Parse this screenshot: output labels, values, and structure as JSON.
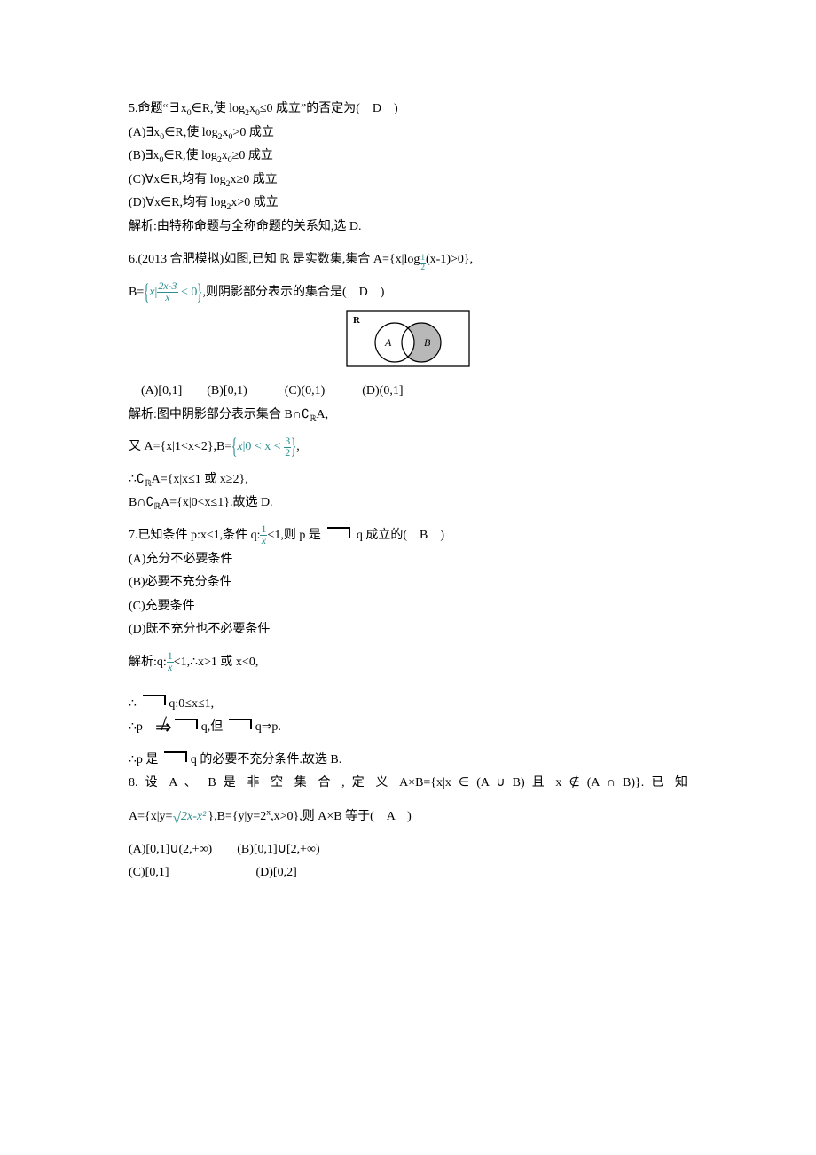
{
  "q5": {
    "stem": "5.命题“∃x₀∈ℝ,使 log₂x₀≤0 成立”的否定为(　D　)",
    "A": "(A)∃x₀∈ℝ,使 log₂x₀>0 成立",
    "B": "(B)∃x₀∈ℝ,使 log₂x₀≥0 成立",
    "C": "(C)∀x∈ℝ,均有 log₂x≥0 成立",
    "D": "(D)∀x∈ℝ,均有 log₂x>0 成立",
    "sol": "解析:由特称命题与全称命题的关系知,选 D."
  },
  "q6": {
    "stem_pre": "6.(2013 合肥模拟)如图,已知 ℝ 是实数集,集合 A={x|lo",
    "stem_log_sub": "g",
    "stem_post": "(x-1)>0},",
    "line2_pre": "B=",
    "line2_inner_x": "x",
    "line2_inner_mid": "|",
    "line2_frac_n": "2x-3",
    "line2_frac_d": "x",
    "line2_lt0": " < 0",
    "line2_post": ",则阴影部分表示的集合是(　D　)",
    "opts": "　(A)[0,1]　　(B)[0,1)　　　(C)(0,1)　　　(D)(0,1]",
    "sol1": "解析:图中阴影部分表示集合 B∩∁",
    "sol1_R": "ℝ",
    "sol1_post": "A,",
    "sol2_pre": "又 A={x|1<x<2},B=",
    "sol2_inner_x": "x",
    "sol2_inner_mid": "|0 < x < ",
    "sol2_frac_n": "3",
    "sol2_frac_d": "2",
    "sol2_post": ",",
    "sol3": "∴∁",
    "sol3_R": "ℝ",
    "sol3_post": "A={x|x≤1 或 x≥2},",
    "sol4": "B∩∁",
    "sol4_R": "ℝ",
    "sol4_post": "A={x|0<x≤1}.故选 D.",
    "venn": {
      "R": "R",
      "A": "A",
      "B": "B"
    }
  },
  "q7": {
    "stem_pre": "7.已知条件 p:x≤1,条件 q:",
    "stem_frac_n": "1",
    "stem_frac_d": "x",
    "stem_mid": "<1,则 p 是",
    "stem_post": "q 成立的(　B　)",
    "A": "(A)充分不必要条件",
    "B": "(B)必要不充分条件",
    "C": "(C)充要条件",
    "D": "(D)既不充分也不必要条件",
    "sol1_pre": "解析:q:",
    "sol1_frac_n": "1",
    "sol1_frac_d": "x",
    "sol1_post": "<1,∴x>1 或 x<0,",
    "sol2_pre": "∴",
    "sol2_post": "q:0≤x≤1,",
    "sol3_pre": "∴p　",
    "sol3_mid1": "q,但",
    "sol3_mid2": "q⇒p.",
    "sol4_pre": "∴p 是",
    "sol4_post": "q 的必要不充分条件.故选 B."
  },
  "q8": {
    "stem": "8. 设 A 、 B 是 非 空 集 合 , 定 义 A×B={x|x ∈ (A ∪ B) 且 x ∉ (A ∩ B)}. 已 知",
    "line2_pre": "A={x|y=",
    "line2_rad": "2x-x²",
    "line2_mid": "},B={y|y=2",
    "line2_exp": "x",
    "line2_post": ",x>0},则 A×B 等于(　A　)",
    "A": "(A)[0,1]∪(2,+∞)",
    "B": "(B)[0,1]∪[2,+∞)",
    "C": "(C)[0,1]",
    "D": "(D)[0,2]"
  }
}
